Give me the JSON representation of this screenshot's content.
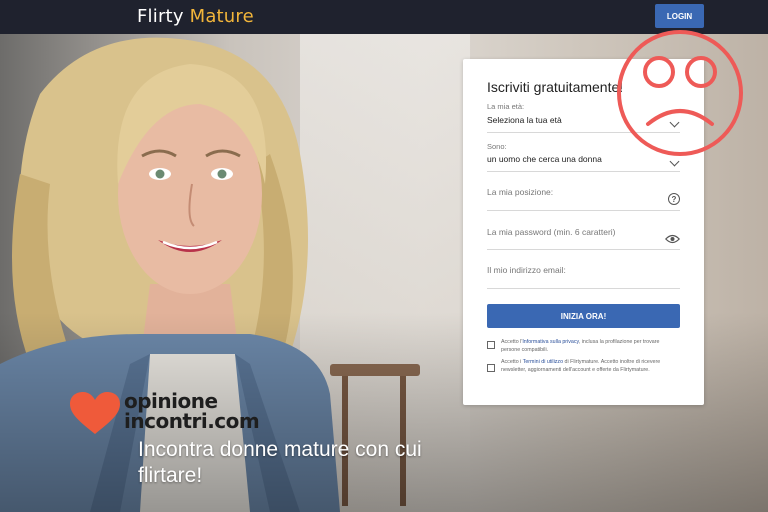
{
  "header": {
    "logo_part1": "Flirty ",
    "logo_part2": "Mature",
    "login_label": "LOGIN"
  },
  "hero": {
    "headline": "Incontra donne mature con cui flirtare!"
  },
  "watermark": {
    "line1": "opinione",
    "line2": "incontri.com"
  },
  "form": {
    "title": "Iscriviti gratuitamente!",
    "age": {
      "label": "La mia età:",
      "value": "Seleziona la tua età"
    },
    "gender": {
      "label": "Sono:",
      "value": "un uomo che cerca una donna"
    },
    "location": {
      "placeholder": "La mia posizione:"
    },
    "password": {
      "placeholder": "La mia password (min. 6 caratteri)"
    },
    "email": {
      "placeholder": "Il mio indirizzo email:"
    },
    "submit_label": "INIZIA ORA!",
    "consent1": {
      "before": "Accetto l'",
      "link": "Informativa sulla privacy",
      "after": ", inclusa la profilazione per trovare persone compatibili."
    },
    "consent2": {
      "before": "Accetto i ",
      "link": "Termini di utilizzo",
      "after": " di Flirtymature. Accetto inoltre di ricevere newsletter, aggiornamenti dell'account e offerte da Flirtymature."
    }
  },
  "colors": {
    "topbar": "#1f222e",
    "accent": "#3a68b3",
    "logo_accent": "#f2b53a",
    "sad_face": "#ee5a57",
    "heart": "#ef5a3a"
  }
}
